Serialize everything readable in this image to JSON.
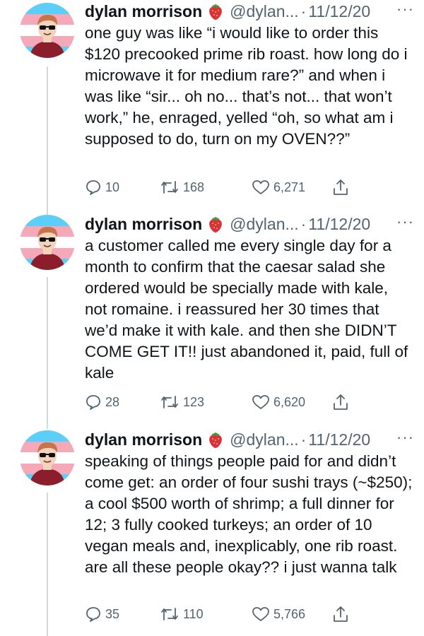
{
  "tweets": [
    {
      "name": "dylan morrison",
      "handle": "@dylan...",
      "separator": "·",
      "date": "11/12/20",
      "more": "···",
      "text": "one guy was like “i would like to order this $120 precooked prime rib roast. how long do i microwave it for medium rare?” and when i was like “sir... oh no... that’s not... that won’t work,” he, enraged, yelled “oh, so what am i supposed to do, turn on my OVEN??”",
      "replies": "10",
      "retweets": "168",
      "likes": "6,271"
    },
    {
      "name": "dylan morrison",
      "handle": "@dylan...",
      "separator": "·",
      "date": "11/12/20",
      "more": "···",
      "text": "a customer called me every single day for a month to confirm that the caesar salad she ordered would be specially made with kale, not romaine. i reassured her 30 times that we’d make it with kale. and then she DIDN’T COME GET IT!! just abandoned it, paid, full of kale",
      "replies": "28",
      "retweets": "123",
      "likes": "6,620"
    },
    {
      "name": "dylan morrison",
      "handle": "@dylan...",
      "separator": "·",
      "date": "11/12/20",
      "more": "···",
      "text": "speaking of things people paid for and didn’t come get: an order of four sushi trays (~$250); a cool $500 worth of shrimp; a full dinner for 12; 3 fully cooked turkeys; an order of 10 vegan meals and, inexplicably, one rib roast. are all these people okay?? i just wanna talk",
      "replies": "35",
      "retweets": "110",
      "likes": "5,766"
    }
  ],
  "colors": {
    "text": "#0f1419",
    "secondary": "#536471",
    "thread_line": "#cfd9de",
    "flag_blue": "#5bcefa",
    "flag_pink": "#f5a9b8",
    "flag_white": "#ffffff"
  },
  "icons": [
    "reply-icon",
    "retweet-icon",
    "like-icon",
    "share-icon",
    "strawberry-emoji",
    "more-icon"
  ]
}
